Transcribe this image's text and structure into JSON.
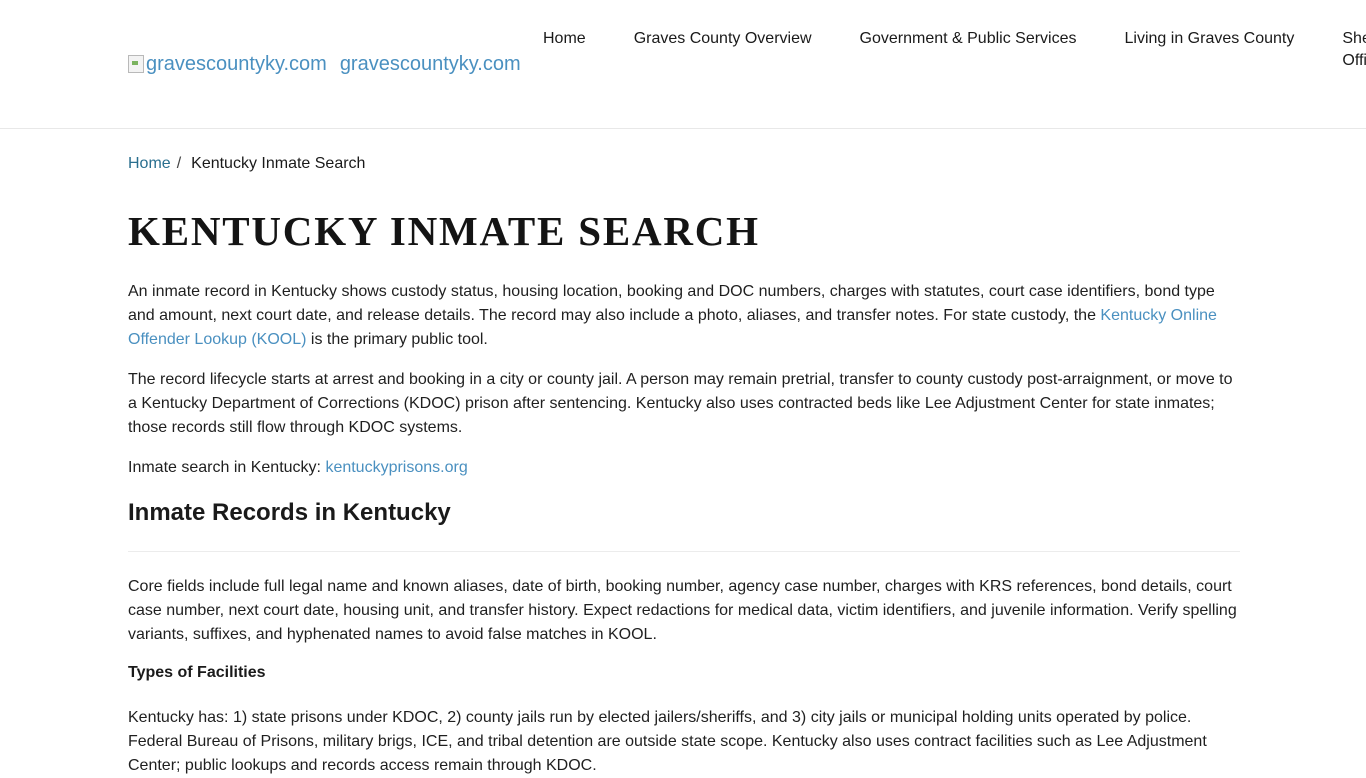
{
  "header": {
    "logo_alt": "gravescountyky.com",
    "site_name": "gravescountyky.com"
  },
  "nav": {
    "items": [
      {
        "label": "Home"
      },
      {
        "label": "Graves County Overview"
      },
      {
        "label": "Government & Public Services"
      },
      {
        "label": "Living in Graves County"
      },
      {
        "label": "Sheriff's Office"
      }
    ]
  },
  "breadcrumb": {
    "home": "Home",
    "separator": "/",
    "current": "Kentucky Inmate Search"
  },
  "main": {
    "title": "KENTUCKY INMATE SEARCH",
    "p1_text": "An inmate record in Kentucky shows custody status, housing location, booking and DOC numbers, charges with statutes, court case identifiers, bond type and amount, next court date, and release details. The record may also include a photo, aliases, and transfer notes. For state custody, the ",
    "p1_link": "Kentucky Online Offender Lookup (KOOL)",
    "p1_after": " is the primary public tool.",
    "p2": "The record lifecycle starts at arrest and booking in a city or county jail. A person may remain pretrial, transfer to county custody post-arraignment, or move to a Kentucky Department of Corrections (KDOC) prison after sentencing. Kentucky also uses contracted beds like Lee Adjustment Center for state inmates; those records still flow through KDOC systems.",
    "p3_text": "Inmate search in Kentucky: ",
    "p3_link": "kentuckyprisons.org",
    "h2": "Inmate Records in Kentucky",
    "p4": "Core fields include full legal name and known aliases, date of birth, booking number, agency case number, charges with KRS references, bond details, court case number, next court date, housing unit, and transfer history. Expect redactions for medical data, victim identifiers, and juvenile information. Verify spelling variants, suffixes, and hyphenated names to avoid false matches in KOOL.",
    "h3": "Types of Facilities",
    "p5": "Kentucky has: 1) state prisons under KDOC, 2) county jails run by elected jailers/sheriffs, and 3) city jails or municipal holding units operated by police. Federal Bureau of Prisons, military brigs, ICE, and tribal detention are outside state scope. Kentucky also uses contract facilities such as Lee Adjustment Center; public lookups and records access remain through KDOC."
  },
  "colors": {
    "link": "#4a90c0",
    "breadcrumb_link": "#2a6f8f",
    "text": "#1f1f1f"
  }
}
